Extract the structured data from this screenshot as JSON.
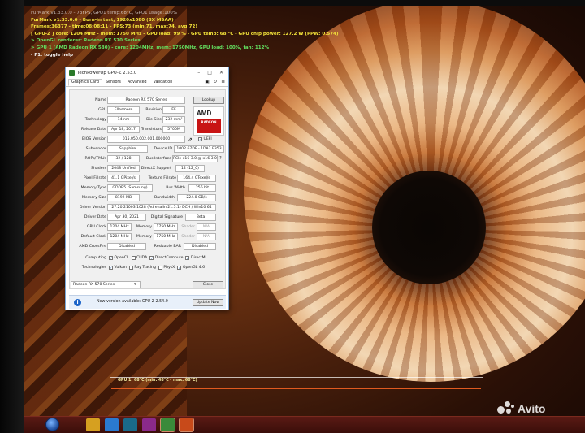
{
  "osd": {
    "line0": "FurMark v1.33.0.0 - 73FPS, GPU1 temp:68°C, GPU1 usage:100%",
    "line1": "FurMark v1.33.0.0 - Burn-in test, 1920x1080 (8X MSAA)",
    "line2": "Frames:36377 - time:08:08:11 - FPS:73 (min:71, max:74, avg:72)",
    "line3": "[ GPU-Z ] core: 1204 MHz - mem: 1750 MHz - GPU load: 99 % - GPU temp: 68 °C - GPU chip power: 127.2 W (PPW: 0.574)",
    "line4": "> OpenGL renderer: Radeon RX 570 Series",
    "line5": "> GPU 1 (AMD Radeon RX 580) - core: 1204MHz, mem: 1750MHz, GPU load: 100%, fan: 112%",
    "line6": "- F1: toggle help"
  },
  "gpuz": {
    "title": "TechPowerUp GPU-Z 2.53.0",
    "tabs": [
      "Graphics Card",
      "Sensors",
      "Advanced",
      "Validation"
    ],
    "lookup": "Lookup",
    "name": "Radeon RX 570 Series",
    "gpu": "Ellesmere",
    "revision_label": "Revision",
    "revision": "EF",
    "technology": "14 nm",
    "die_size_label": "Die Size",
    "die_size": "232 mm²",
    "release_date": "Apr 18, 2017",
    "transistors_label": "Transistors",
    "transistors": "5700M",
    "bios_version": "015.050.002.001.000000",
    "uefi": "UEFI",
    "subvendor": "Sapphire",
    "device_id_label": "Device ID",
    "device_id": "1002 67DF - 1DA2 E353",
    "rops_tmus": "32 / 128",
    "bus_interface_label": "Bus Interface",
    "bus_interface": "PCIe x16 3.0 @ x16 3.0",
    "shaders": "2048 Unified",
    "directx_label": "DirectX Support",
    "directx": "12 (12_0)",
    "pixel_fillrate": "41.1 GPixel/s",
    "texture_fillrate_label": "Texture Fillrate",
    "texture_fillrate": "164.4 GTexel/s",
    "memory_type": "GDDR5 (Samsung)",
    "bus_width_label": "Bus Width",
    "bus_width": "256 bit",
    "memory_size": "8192 MB",
    "bandwidth_label": "Bandwidth",
    "bandwidth": "224.0 GB/s",
    "driver_version": "27.20.21003.1028 (Adrenalin 21.5.1) DCH / Win10 64",
    "driver_date": "Apr 30, 2021",
    "digital_signature_label": "Digital Signature",
    "digital_signature": "Beta",
    "gpu_clock": "1204 MHz",
    "memory_label": "Memory",
    "gpu_memory": "1750 MHz",
    "shader_label": "Shader",
    "shader_value": "N/A",
    "default_clock": "1204 MHz",
    "default_memory": "1750 MHz",
    "default_shader": "N/A",
    "crossfire": "Disabled",
    "resizable_bar_label": "Resizable BAR",
    "resizable_bar": "Disabled",
    "labels": {
      "name": "Name",
      "gpu": "GPU",
      "technology": "Technology",
      "release_date": "Release Date",
      "bios_version": "BIOS Version",
      "subvendor": "Subvendor",
      "rops_tmus": "ROPs/TMUs",
      "shaders": "Shaders",
      "pixel_fillrate": "Pixel Fillrate",
      "memory_type": "Memory Type",
      "memory_size": "Memory Size",
      "driver_version": "Driver Version",
      "driver_date": "Driver Date",
      "gpu_clock": "GPU Clock",
      "default_clock": "Default Clock",
      "crossfire": "AMD CrossFire",
      "computing": "Computing",
      "technologies": "Technologies"
    },
    "computing": [
      "OpenCL",
      "CUDA",
      "DirectCompute",
      "DirectML"
    ],
    "technologies": [
      "Vulkan",
      "Ray Tracing",
      "PhysX",
      "OpenGL 4.6"
    ],
    "selected_card": "Radeon RX 570 Series",
    "close": "Close",
    "notice": "New version available: GPU-Z 2.54.0",
    "update_now": "Update Now",
    "amd_logo": "AMD",
    "radeon_logo": "RADEON GRAPHICS"
  },
  "graph": {
    "label": "GPU 1: 68°C (min: 48°C - max: 68°C)"
  },
  "watermark": {
    "text": "Avito"
  },
  "colors": {
    "osd_yellow": "#f2e23a",
    "osd_green": "#64e060",
    "amd_red": "#c81414",
    "info_blue": "#1c64c8"
  }
}
